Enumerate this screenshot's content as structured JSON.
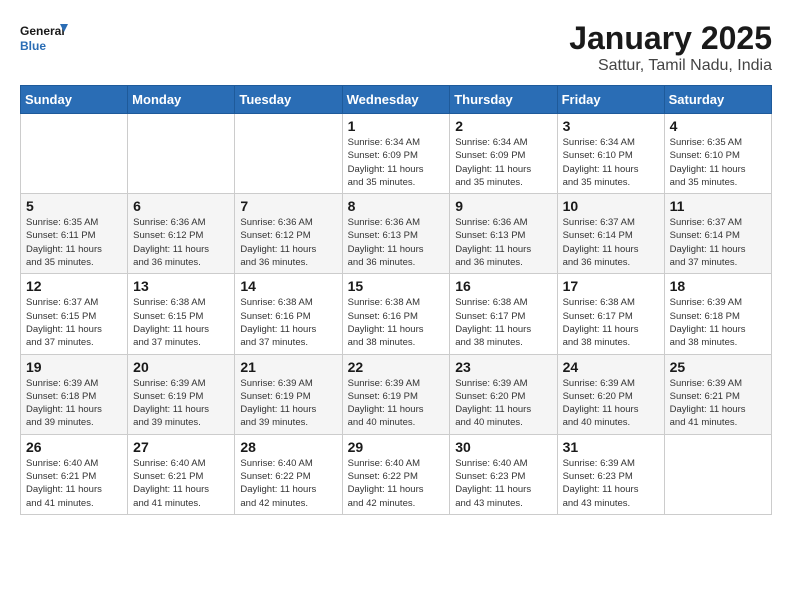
{
  "logo": {
    "line1": "General",
    "line2": "Blue"
  },
  "title": "January 2025",
  "subtitle": "Sattur, Tamil Nadu, India",
  "weekdays": [
    "Sunday",
    "Monday",
    "Tuesday",
    "Wednesday",
    "Thursday",
    "Friday",
    "Saturday"
  ],
  "weeks": [
    [
      {
        "day": "",
        "info": ""
      },
      {
        "day": "",
        "info": ""
      },
      {
        "day": "",
        "info": ""
      },
      {
        "day": "1",
        "info": "Sunrise: 6:34 AM\nSunset: 6:09 PM\nDaylight: 11 hours\nand 35 minutes."
      },
      {
        "day": "2",
        "info": "Sunrise: 6:34 AM\nSunset: 6:09 PM\nDaylight: 11 hours\nand 35 minutes."
      },
      {
        "day": "3",
        "info": "Sunrise: 6:34 AM\nSunset: 6:10 PM\nDaylight: 11 hours\nand 35 minutes."
      },
      {
        "day": "4",
        "info": "Sunrise: 6:35 AM\nSunset: 6:10 PM\nDaylight: 11 hours\nand 35 minutes."
      }
    ],
    [
      {
        "day": "5",
        "info": "Sunrise: 6:35 AM\nSunset: 6:11 PM\nDaylight: 11 hours\nand 35 minutes."
      },
      {
        "day": "6",
        "info": "Sunrise: 6:36 AM\nSunset: 6:12 PM\nDaylight: 11 hours\nand 36 minutes."
      },
      {
        "day": "7",
        "info": "Sunrise: 6:36 AM\nSunset: 6:12 PM\nDaylight: 11 hours\nand 36 minutes."
      },
      {
        "day": "8",
        "info": "Sunrise: 6:36 AM\nSunset: 6:13 PM\nDaylight: 11 hours\nand 36 minutes."
      },
      {
        "day": "9",
        "info": "Sunrise: 6:36 AM\nSunset: 6:13 PM\nDaylight: 11 hours\nand 36 minutes."
      },
      {
        "day": "10",
        "info": "Sunrise: 6:37 AM\nSunset: 6:14 PM\nDaylight: 11 hours\nand 36 minutes."
      },
      {
        "day": "11",
        "info": "Sunrise: 6:37 AM\nSunset: 6:14 PM\nDaylight: 11 hours\nand 37 minutes."
      }
    ],
    [
      {
        "day": "12",
        "info": "Sunrise: 6:37 AM\nSunset: 6:15 PM\nDaylight: 11 hours\nand 37 minutes."
      },
      {
        "day": "13",
        "info": "Sunrise: 6:38 AM\nSunset: 6:15 PM\nDaylight: 11 hours\nand 37 minutes."
      },
      {
        "day": "14",
        "info": "Sunrise: 6:38 AM\nSunset: 6:16 PM\nDaylight: 11 hours\nand 37 minutes."
      },
      {
        "day": "15",
        "info": "Sunrise: 6:38 AM\nSunset: 6:16 PM\nDaylight: 11 hours\nand 38 minutes."
      },
      {
        "day": "16",
        "info": "Sunrise: 6:38 AM\nSunset: 6:17 PM\nDaylight: 11 hours\nand 38 minutes."
      },
      {
        "day": "17",
        "info": "Sunrise: 6:38 AM\nSunset: 6:17 PM\nDaylight: 11 hours\nand 38 minutes."
      },
      {
        "day": "18",
        "info": "Sunrise: 6:39 AM\nSunset: 6:18 PM\nDaylight: 11 hours\nand 38 minutes."
      }
    ],
    [
      {
        "day": "19",
        "info": "Sunrise: 6:39 AM\nSunset: 6:18 PM\nDaylight: 11 hours\nand 39 minutes."
      },
      {
        "day": "20",
        "info": "Sunrise: 6:39 AM\nSunset: 6:19 PM\nDaylight: 11 hours\nand 39 minutes."
      },
      {
        "day": "21",
        "info": "Sunrise: 6:39 AM\nSunset: 6:19 PM\nDaylight: 11 hours\nand 39 minutes."
      },
      {
        "day": "22",
        "info": "Sunrise: 6:39 AM\nSunset: 6:19 PM\nDaylight: 11 hours\nand 40 minutes."
      },
      {
        "day": "23",
        "info": "Sunrise: 6:39 AM\nSunset: 6:20 PM\nDaylight: 11 hours\nand 40 minutes."
      },
      {
        "day": "24",
        "info": "Sunrise: 6:39 AM\nSunset: 6:20 PM\nDaylight: 11 hours\nand 40 minutes."
      },
      {
        "day": "25",
        "info": "Sunrise: 6:39 AM\nSunset: 6:21 PM\nDaylight: 11 hours\nand 41 minutes."
      }
    ],
    [
      {
        "day": "26",
        "info": "Sunrise: 6:40 AM\nSunset: 6:21 PM\nDaylight: 11 hours\nand 41 minutes."
      },
      {
        "day": "27",
        "info": "Sunrise: 6:40 AM\nSunset: 6:21 PM\nDaylight: 11 hours\nand 41 minutes."
      },
      {
        "day": "28",
        "info": "Sunrise: 6:40 AM\nSunset: 6:22 PM\nDaylight: 11 hours\nand 42 minutes."
      },
      {
        "day": "29",
        "info": "Sunrise: 6:40 AM\nSunset: 6:22 PM\nDaylight: 11 hours\nand 42 minutes."
      },
      {
        "day": "30",
        "info": "Sunrise: 6:40 AM\nSunset: 6:23 PM\nDaylight: 11 hours\nand 43 minutes."
      },
      {
        "day": "31",
        "info": "Sunrise: 6:39 AM\nSunset: 6:23 PM\nDaylight: 11 hours\nand 43 minutes."
      },
      {
        "day": "",
        "info": ""
      }
    ]
  ]
}
